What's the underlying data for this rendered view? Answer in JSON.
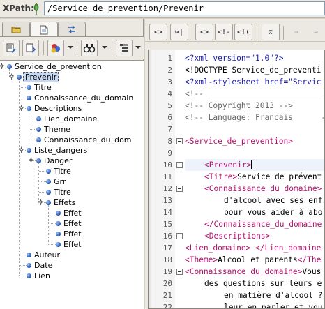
{
  "xpath": {
    "label": "XPath:",
    "value": "/Service_de_prevention/Prevenir"
  },
  "left_panel": {
    "tabs": [
      {
        "icon": "folder-icon",
        "active": false
      },
      {
        "icon": "document-icon",
        "active": true
      },
      {
        "icon": "arrows-icon",
        "active": false
      }
    ],
    "toolbar": [
      {
        "icon": "edit-element-icon"
      },
      {
        "icon": "refresh-tree-icon"
      },
      {
        "icon": "palette-icon",
        "dropdown": true
      },
      {
        "icon": "binoculars-icon",
        "dropdown": true
      },
      {
        "icon": "outline-view-icon",
        "dropdown": true
      }
    ],
    "tree": [
      {
        "label": "Service_de_prevention",
        "depth": 0,
        "expanded": true
      },
      {
        "label": "Prevenir",
        "depth": 1,
        "expanded": true,
        "selected": true
      },
      {
        "label": "Titre",
        "depth": 2
      },
      {
        "label": "Connaissance_du_domain",
        "depth": 2
      },
      {
        "label": "Descriptions",
        "depth": 2,
        "expanded": true
      },
      {
        "label": "Lien_domaine",
        "depth": 3
      },
      {
        "label": "Theme",
        "depth": 3
      },
      {
        "label": "Connaissance_du_dom",
        "depth": 3
      },
      {
        "label": "Liste_dangers",
        "depth": 2,
        "expanded": true
      },
      {
        "label": "Danger",
        "depth": 3,
        "expanded": true
      },
      {
        "label": "Titre",
        "depth": 4
      },
      {
        "label": "Grr",
        "depth": 4
      },
      {
        "label": "Titre",
        "depth": 4
      },
      {
        "label": "Effets",
        "depth": 4,
        "expanded": true
      },
      {
        "label": "Effet",
        "depth": 5
      },
      {
        "label": "Effet",
        "depth": 5
      },
      {
        "label": "Effet",
        "depth": 5
      },
      {
        "label": "Effet",
        "depth": 5
      },
      {
        "label": "Auteur",
        "depth": 2
      },
      {
        "label": "Date",
        "depth": 2
      },
      {
        "label": "Lien",
        "depth": 2
      }
    ]
  },
  "editor": {
    "toolbar": [
      {
        "label": "<>",
        "icon": "tag-view-icon"
      },
      {
        "label": "⊳|",
        "icon": "split-tags-icon"
      },
      {
        "label": "<>",
        "icon": "tag-pair-icon"
      },
      {
        "label": "<!-",
        "icon": "comment-icon"
      },
      {
        "label": "<!(",
        "icon": "cdata-icon"
      },
      {
        "label": "⌆",
        "icon": "format-indent-icon"
      },
      {
        "label": "⇒",
        "icon": "next-disabled-icon",
        "disabled": true
      },
      {
        "label": "⇝",
        "icon": "jump-disabled-icon",
        "disabled": true
      }
    ],
    "lines": [
      {
        "n": "1",
        "text": "<?xml version=\"1.0\"?>",
        "kind": "pi",
        "indent": 0
      },
      {
        "n": "2",
        "text": "<!DOCTYPE Service_de_preventi",
        "kind": "doc",
        "indent": 0
      },
      {
        "n": "3",
        "text": "<?xml-stylesheet href=\"Servic",
        "kind": "pi",
        "indent": 0
      },
      {
        "n": "4",
        "text": "<!-- ________________________",
        "kind": "cm",
        "indent": 0
      },
      {
        "n": "5",
        "text": "<!-- Copyright 2013 -->",
        "kind": "cm",
        "indent": 0
      },
      {
        "n": "6",
        "text": "<!-- Language: Francais      -",
        "kind": "cm",
        "indent": 0
      },
      {
        "n": "7",
        "text": "",
        "kind": "txt",
        "indent": 0
      },
      {
        "n": "8",
        "text": "<Service_de_prevention>",
        "kind": "tag",
        "indent": 0,
        "fold": true
      },
      {
        "n": "9",
        "text": "",
        "kind": "txt",
        "indent": 0
      },
      {
        "n": "10",
        "text": "<Prevenir>",
        "kind": "tag",
        "indent": 1,
        "fold": true,
        "current": true
      },
      {
        "n": "11",
        "tag": "<Titre>",
        "text": "Service de prévent",
        "kind": "mix",
        "indent": 1
      },
      {
        "n": "12",
        "text": "<Connaissance_du_domaine>",
        "kind": "tag",
        "indent": 1,
        "fold": true
      },
      {
        "n": "13",
        "text": "d'alcool avec ses enf",
        "kind": "txt",
        "indent": 2
      },
      {
        "n": "14",
        "text": "pour vous aider à abo",
        "kind": "txt",
        "indent": 2
      },
      {
        "n": "15",
        "text": "</Connaissance_du_domaine",
        "kind": "tag",
        "indent": 1
      },
      {
        "n": "16",
        "text": "<Descriptions>",
        "kind": "tag",
        "indent": 1,
        "fold": true
      },
      {
        "n": "17",
        "tag": "<Lien_domaine>",
        "text": " </Lien_domaine",
        "kind": "mix2",
        "indent": 0
      },
      {
        "n": "18",
        "tag": "<Theme>",
        "text": "Alcool et parents",
        "tail": "</The",
        "kind": "mix3",
        "indent": 0
      },
      {
        "n": "19",
        "tag": "<Connaissance_du_domaine>",
        "text": "Vous",
        "kind": "mix",
        "indent": 0,
        "fold": true
      },
      {
        "n": "20",
        "text": "des questions sur leurs e",
        "kind": "txt",
        "indent": 1
      },
      {
        "n": "21",
        "text": "en matière d'alcool ?",
        "kind": "txt",
        "indent": 2
      },
      {
        "n": "22",
        "text": "leur en parler et vou",
        "kind": "txt",
        "indent": 2
      }
    ]
  }
}
